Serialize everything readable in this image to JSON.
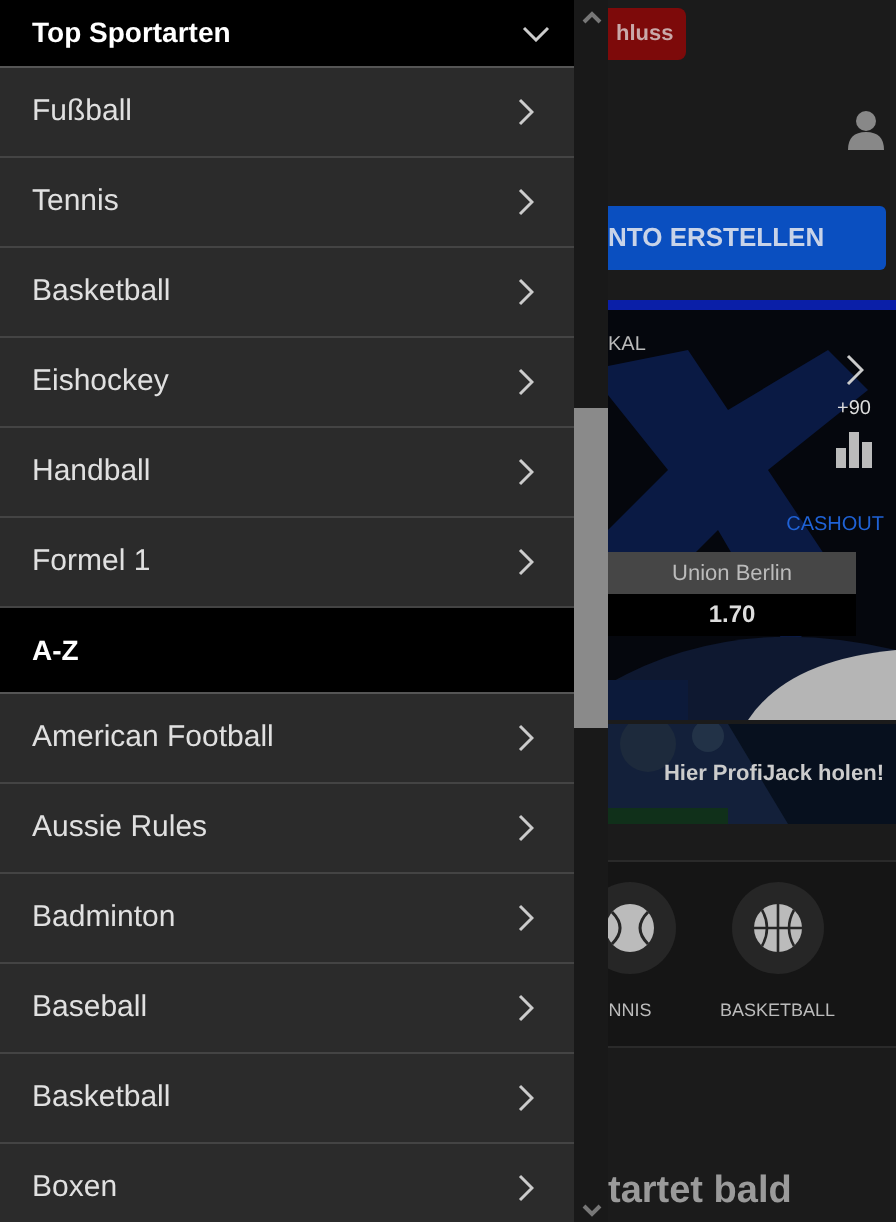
{
  "menu": {
    "sections": [
      {
        "title": "Top Sportarten",
        "expanded": true,
        "items": [
          "Fußball",
          "Tennis",
          "Basketball",
          "Eishockey",
          "Handball",
          "Formel 1"
        ]
      },
      {
        "title": "A-Z",
        "items": [
          "American Football",
          "Aussie Rules",
          "Badminton",
          "Baseball",
          "Basketball",
          "Boxen"
        ]
      }
    ]
  },
  "background_page": {
    "top_button": "hluss",
    "cta_button": "NTO ERSTELLEN",
    "match_card": {
      "league": "KAL",
      "more_markets": "+90",
      "cashout": "CASHOUT",
      "outcome": {
        "team": "Union Berlin",
        "odds": "1.70"
      }
    },
    "promo_banner": "Hier ProfiJack holen!",
    "sports": [
      {
        "label": "NNIS",
        "kind": "tennis"
      },
      {
        "label": "BASKETBALL",
        "kind": "basketball"
      }
    ],
    "heading": "tartet bald"
  }
}
